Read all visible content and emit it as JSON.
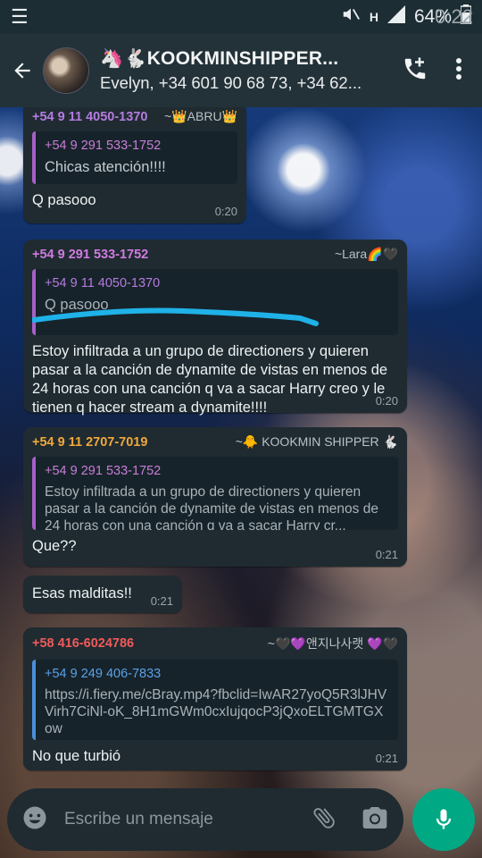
{
  "status_bar": {
    "battery": "64%",
    "time": "0:22"
  },
  "header": {
    "group_name": "🦄🐇KOOKMINSHIPPER...",
    "participants": "Evelyn, +34 601 90 68 73, +34 62..."
  },
  "messages": [
    {
      "sender": "+54 9 11 4050-1370",
      "tag": "~👑ABRU👑",
      "quote_name": "+54 9 291 533-1752",
      "quote_text": "Chicas atención!!!!",
      "text": "Q pasooo",
      "time": "0:20"
    },
    {
      "sender": "+54 9 291 533-1752",
      "tag": "~Lara🌈🖤",
      "quote_name": "+54 9 11 4050-1370",
      "quote_text": "Q pasooo",
      "text": "Estoy infiltrada a un grupo de directioners y quieren pasar a la canción de dynamite de vistas en menos de 24 horas con una canción q va a sacar Harry creo y le tienen q hacer stream a dynamite!!!!",
      "time": "0:20"
    },
    {
      "sender": "+54 9 11 2707-7019",
      "tag": "~🐥 KOOKMIN SHIPPER 🐇",
      "quote_name": "+54 9 291 533-1752",
      "quote_text": "Estoy infiltrada a un grupo de directioners y quieren pasar a la canción de dynamite de vistas en menos de 24 horas con una canción q va a sacar Harry cr...",
      "text": "Que??",
      "time": "0:21"
    },
    {
      "text": "Esas malditas!!",
      "time": "0:21"
    },
    {
      "sender": "+58 416-6024786",
      "tag": "~🖤💜앤지나사랫 💜🖤",
      "quote_name": "+54 9 249 406-7833",
      "quote_text": "https://i.fiery.me/cBray.mp4?fbclid=IwAR27yoQ5R3lJHVVirh7CiNl-oK_8H1mGWm0cxIujqocP3jQxoELTGMTGXow",
      "text": "No que turbió",
      "time": "0:21"
    }
  ],
  "input": {
    "placeholder": "Escribe un mensaje"
  },
  "colors": {
    "header_bg": "#233238",
    "bubble_bg": "#1f2b31",
    "accent_green": "#00a884",
    "quote_bar": "#a660c6"
  }
}
